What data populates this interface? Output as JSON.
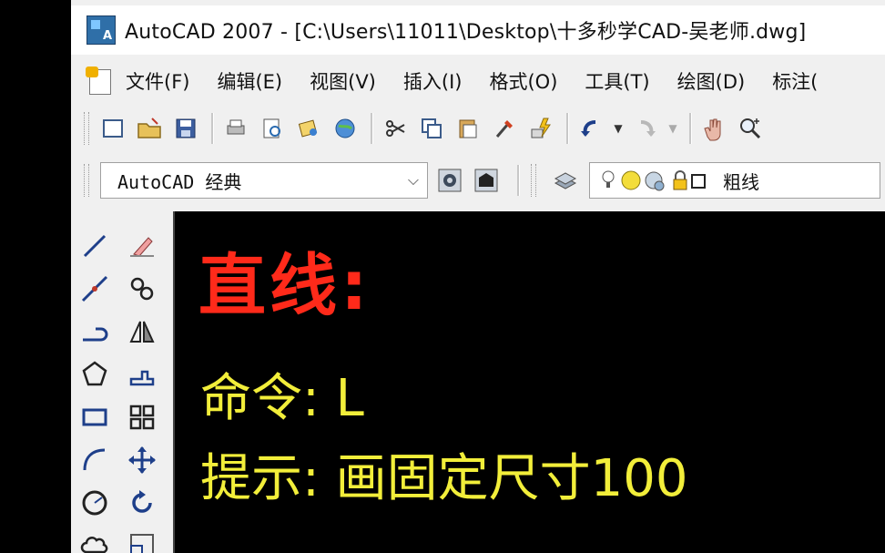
{
  "window": {
    "title": "AutoCAD 2007 - [C:\\Users\\11011\\Desktop\\十多秒学CAD-吴老师.dwg]"
  },
  "menu": {
    "items": [
      {
        "label": "文件(F)"
      },
      {
        "label": "编辑(E)"
      },
      {
        "label": "视图(V)"
      },
      {
        "label": "插入(I)"
      },
      {
        "label": "格式(O)"
      },
      {
        "label": "工具(T)"
      },
      {
        "label": "绘图(D)"
      },
      {
        "label": "标注("
      }
    ]
  },
  "workspace": {
    "selected": "AutoCAD 经典"
  },
  "layer": {
    "current": "粗线"
  },
  "overlay": {
    "heading": "直线:",
    "line1": "命令:  L",
    "line2": "提示:  画固定尺寸100"
  },
  "colors": {
    "heading": "#ff2a1a",
    "body_text": "#f2ee3a",
    "canvas": "#000000"
  }
}
